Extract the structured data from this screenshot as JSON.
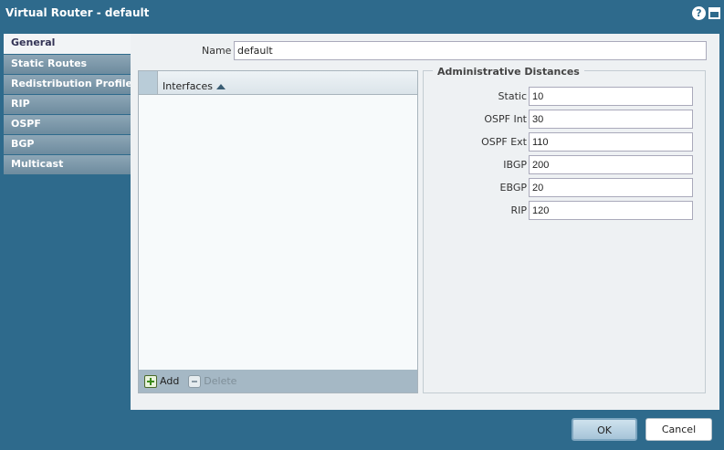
{
  "window": {
    "title": "Virtual Router - default",
    "help_icon": "help-icon",
    "maximize_icon": "maximize-icon"
  },
  "tabs": [
    {
      "label": "General",
      "active": true
    },
    {
      "label": "Static Routes",
      "active": false
    },
    {
      "label": "Redistribution Profiles",
      "active": false
    },
    {
      "label": "RIP",
      "active": false
    },
    {
      "label": "OSPF",
      "active": false
    },
    {
      "label": "BGP",
      "active": false
    },
    {
      "label": "Multicast",
      "active": false
    }
  ],
  "name_field": {
    "label": "Name",
    "value": "default"
  },
  "interfaces_grid": {
    "column": "Interfaces",
    "sort": "ascending",
    "rows": [],
    "add_label": "Add",
    "delete_label": "Delete"
  },
  "admin_distances": {
    "legend": "Administrative Distances",
    "rows": [
      {
        "label": "Static",
        "value": "10"
      },
      {
        "label": "OSPF Int",
        "value": "30"
      },
      {
        "label": "OSPF Ext",
        "value": "110"
      },
      {
        "label": "IBGP",
        "value": "200"
      },
      {
        "label": "EBGP",
        "value": "20"
      },
      {
        "label": "RIP",
        "value": "120"
      }
    ]
  },
  "buttons": {
    "ok": "OK",
    "cancel": "Cancel"
  },
  "colors": {
    "background": "#2e6a8c",
    "tab": "#7893a5",
    "panel": "#eef1f3"
  }
}
